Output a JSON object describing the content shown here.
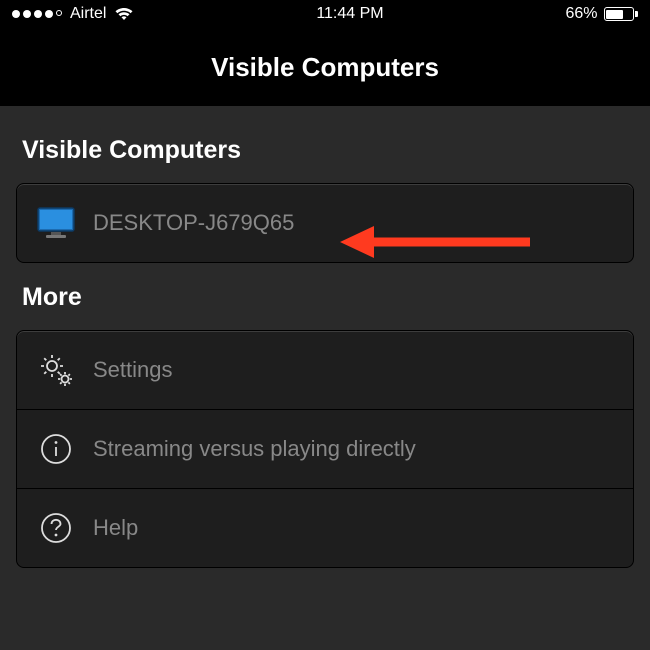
{
  "status_bar": {
    "carrier": "Airtel",
    "time": "11:44 PM",
    "battery_percent": "66%",
    "battery_fill": 66
  },
  "nav": {
    "title": "Visible Computers"
  },
  "sections": {
    "visible": {
      "header": "Visible Computers",
      "items": [
        {
          "label": "DESKTOP-J679Q65",
          "icon": "monitor-icon"
        }
      ]
    },
    "more": {
      "header": "More",
      "items": [
        {
          "label": "Settings",
          "icon": "gear-icon"
        },
        {
          "label": "Streaming versus playing directly",
          "icon": "info-icon"
        },
        {
          "label": "Help",
          "icon": "question-icon"
        }
      ]
    }
  },
  "annotation": {
    "arrow_color": "#ff3a1f"
  }
}
